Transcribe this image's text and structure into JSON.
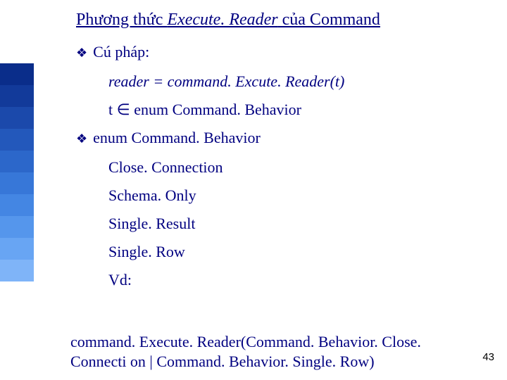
{
  "title": {
    "prefix": "Phương thức ",
    "emph": "Execute. Reader",
    "suffix": " của Command"
  },
  "bullets": {
    "b1": "Cú pháp:",
    "b2": "enum Command. Behavior"
  },
  "subs": {
    "readerLine": "reader = command. Excute. Reader(t)",
    "tline_prefix": "t ",
    "tline_symbol": "∈",
    "tline_suffix": " enum Command. Behavior",
    "closeConn": "Close. Connection",
    "schemaOnly": "Schema. Only",
    "singleResult": "Single. Result",
    "singleRow": "Single. Row",
    "vd": "Vd:"
  },
  "bottom": "command. Execute. Reader(Command. Behavior. Close. Connecti on | Command. Behavior. Single. Row)",
  "pageNumber": "43",
  "sidebarColors": [
    "#0a2d8a",
    "#123a9a",
    "#1b49ab",
    "#2358bb",
    "#2c67ca",
    "#3777d8",
    "#4486e3",
    "#5596ec",
    "#68a5f3",
    "#7fb4f8"
  ]
}
